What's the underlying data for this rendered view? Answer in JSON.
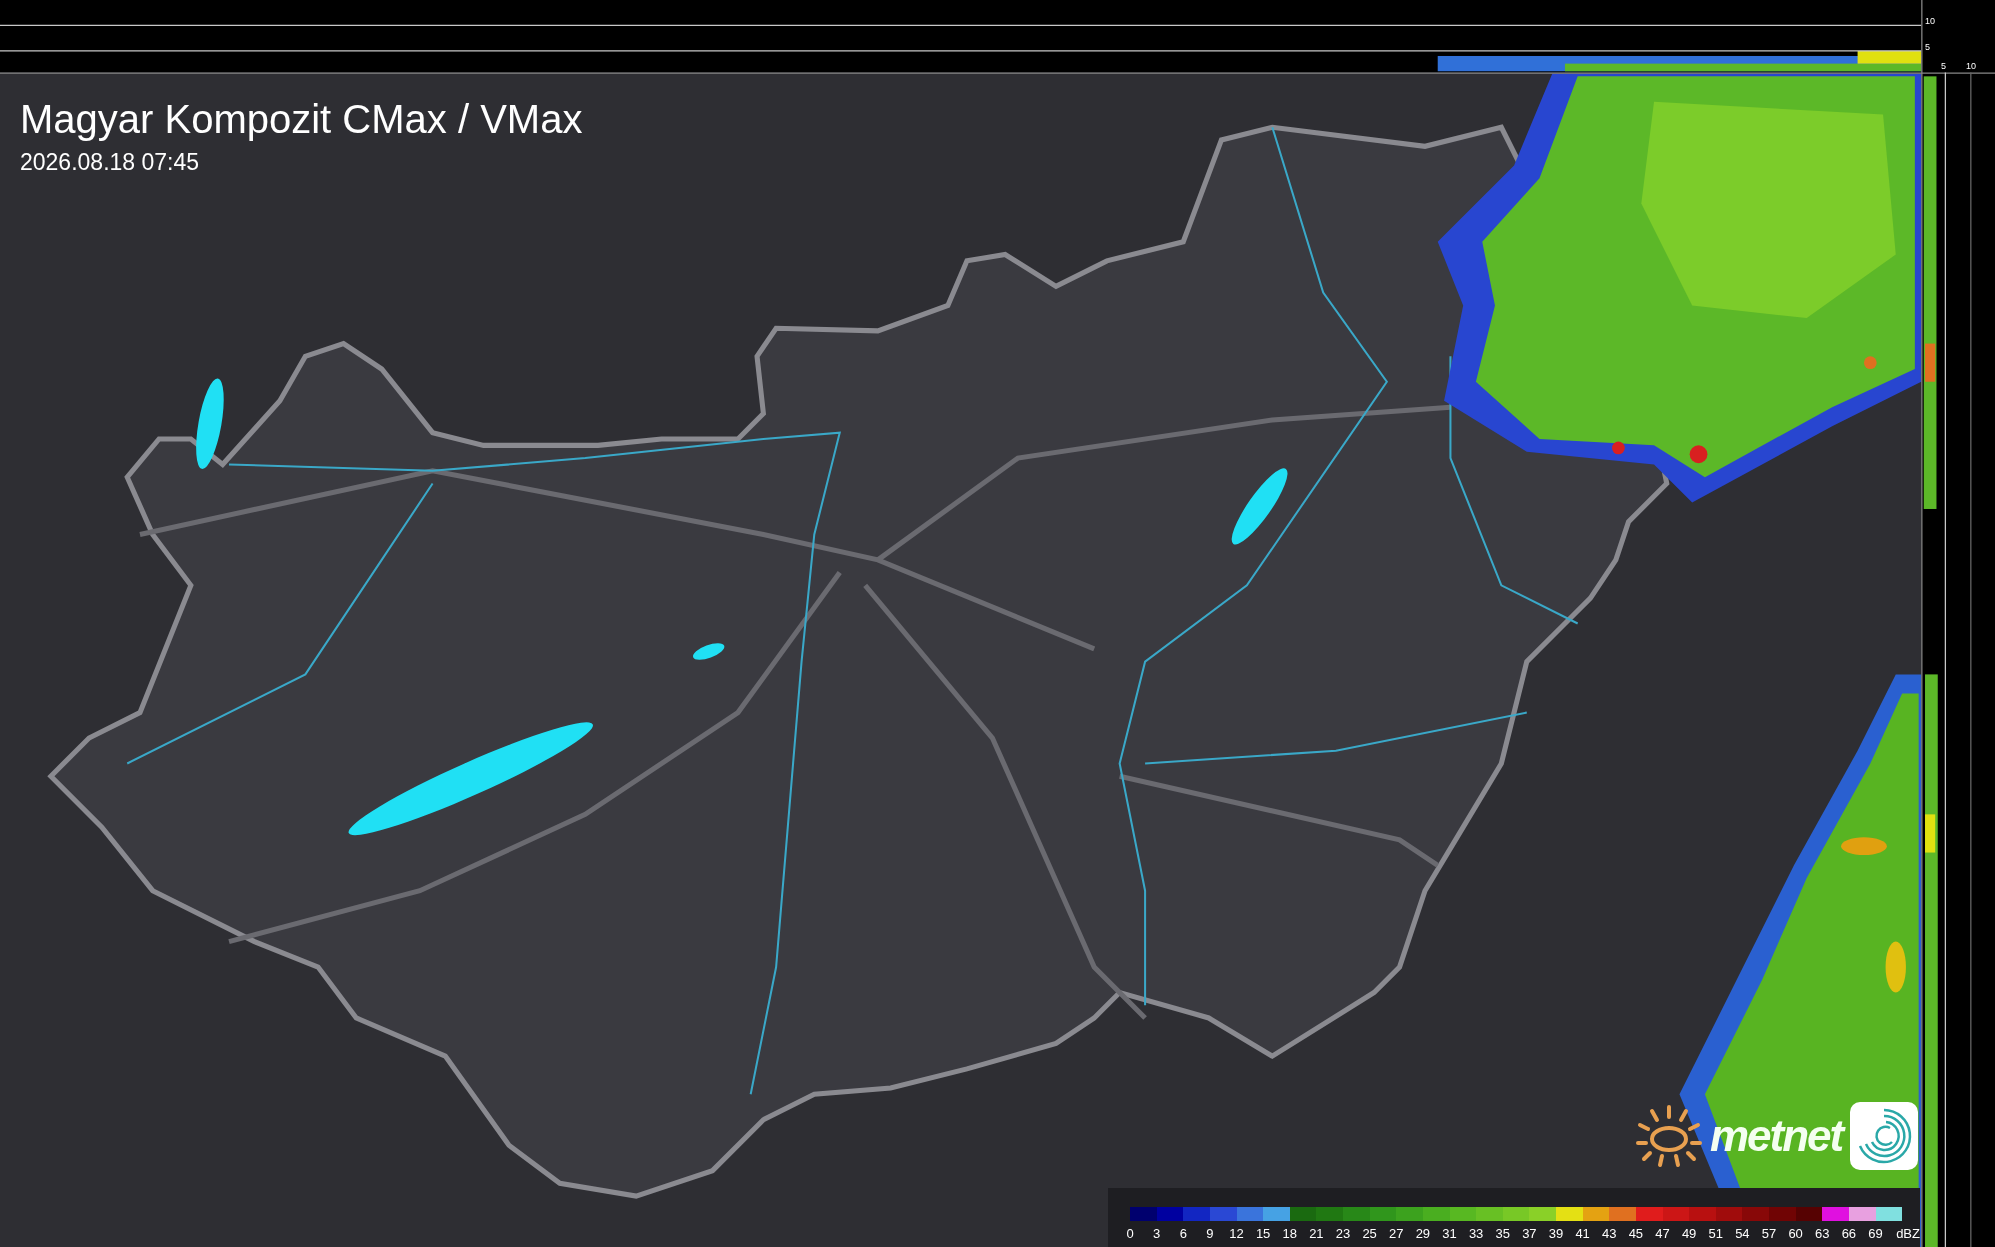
{
  "title": "Magyar Kompozit CMax / VMax",
  "timestamp": "2026.08.18 07:45",
  "top_axis_labels": [
    "10",
    "5"
  ],
  "side_axis_labels": [
    "5",
    "10"
  ],
  "logo": {
    "text": "metnet"
  },
  "legend": {
    "unit": "dBZ",
    "items": [
      {
        "label": "0",
        "color": "#00006e"
      },
      {
        "label": "3",
        "color": "#0000a0"
      },
      {
        "label": "6",
        "color": "#1226c2"
      },
      {
        "label": "9",
        "color": "#2a48d4"
      },
      {
        "label": "12",
        "color": "#3a74dc"
      },
      {
        "label": "15",
        "color": "#46a2e4"
      },
      {
        "label": "18",
        "color": "#1a6a10"
      },
      {
        "label": "21",
        "color": "#207812"
      },
      {
        "label": "23",
        "color": "#288818"
      },
      {
        "label": "25",
        "color": "#30961c"
      },
      {
        "label": "27",
        "color": "#3ca21e"
      },
      {
        "label": "29",
        "color": "#4aae20"
      },
      {
        "label": "31",
        "color": "#58b822"
      },
      {
        "label": "33",
        "color": "#68c024"
      },
      {
        "label": "35",
        "color": "#78c826"
      },
      {
        "label": "37",
        "color": "#8ad028"
      },
      {
        "label": "39",
        "color": "#e4e014"
      },
      {
        "label": "41",
        "color": "#e4a212"
      },
      {
        "label": "43",
        "color": "#e07020"
      },
      {
        "label": "45",
        "color": "#e01c1c"
      },
      {
        "label": "47",
        "color": "#cc1616"
      },
      {
        "label": "49",
        "color": "#b81010"
      },
      {
        "label": "51",
        "color": "#a00c0c"
      },
      {
        "label": "54",
        "color": "#880808"
      },
      {
        "label": "57",
        "color": "#700404"
      },
      {
        "label": "60",
        "color": "#560202"
      },
      {
        "label": "63",
        "color": "#e010e0"
      },
      {
        "label": "66",
        "color": "#e8a0e0"
      },
      {
        "label": "69",
        "color": "#80e0e0"
      }
    ]
  }
}
